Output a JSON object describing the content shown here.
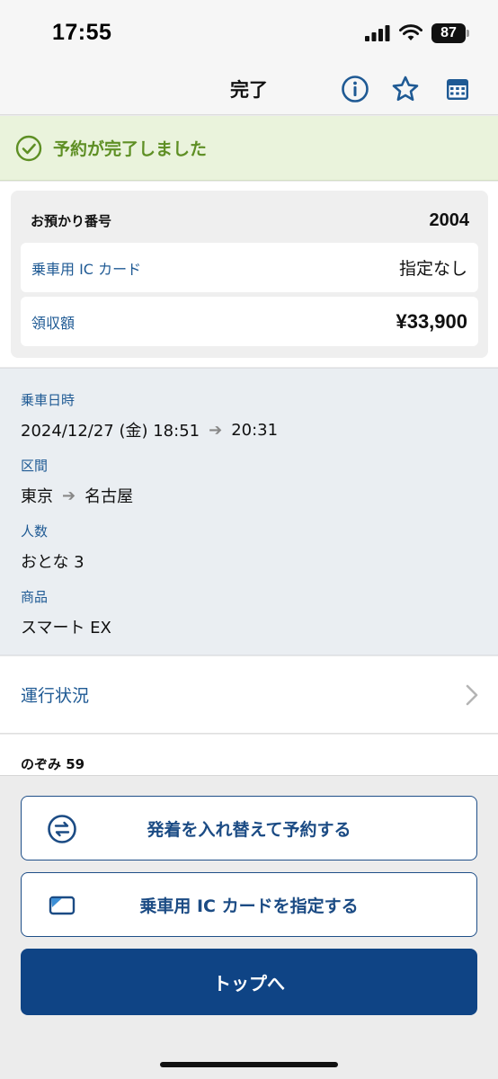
{
  "status_bar": {
    "time": "17:55",
    "battery": "87"
  },
  "nav": {
    "title": "完了",
    "icons": [
      "info-icon",
      "star-icon",
      "calendar-icon"
    ]
  },
  "banner": {
    "text": "予約が完了しました",
    "icon": "check-circle-icon"
  },
  "summary": {
    "reference_label": "お預かり番号",
    "reference_number": "2004",
    "ic_card_label": "乗車用 IC カード",
    "ic_card_value": "指定なし",
    "receipt_label": "領収額",
    "receipt_value": "¥33,900"
  },
  "details": {
    "datetime_label": "乗車日時",
    "date": "2024/12/27 (金) 18:51",
    "arrive_time": "20:31",
    "section_label": "区間",
    "from": "東京",
    "to": "名古屋",
    "people_label": "人数",
    "people": "おとな 3",
    "product_label": "商品",
    "product": "スマート EX"
  },
  "operation": {
    "label": "運行状況"
  },
  "train": {
    "name": "のぞみ 59"
  },
  "actions": {
    "swap_label": "発着を入れ替えて予約する",
    "ic_label": "乗車用 IC カードを指定する",
    "top_label": "トップへ"
  },
  "colors": {
    "accent": "#1f5a94",
    "primary_button": "#0f4485",
    "success_green": "#5e8f24",
    "banner_bg": "#eaf3dc"
  }
}
